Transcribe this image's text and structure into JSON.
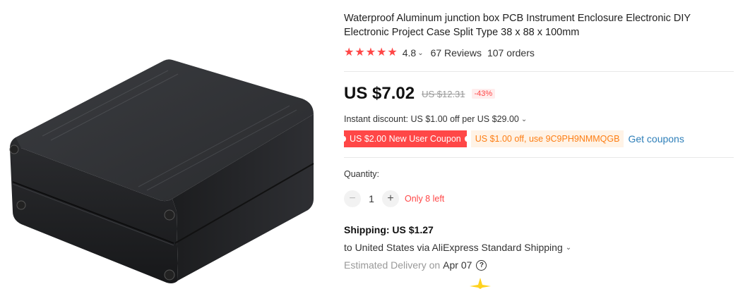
{
  "product": {
    "title": "Waterproof Aluminum junction box PCB Instrument Enclosure Electronic DIY Electronic Project Case Split Type 38 x 88 x 100mm",
    "image_alt": "Black aluminum enclosure box"
  },
  "rating": {
    "stars": 5,
    "value": "4.8",
    "reviews": "67 Reviews",
    "orders": "107 orders"
  },
  "price": {
    "current": "US $7.02",
    "original": "US $12.31",
    "discount": "-43%"
  },
  "instant_discount": "Instant discount: US $1.00 off per US $29.00",
  "coupons": {
    "new_user": "US $2.00 New User Coupon",
    "code_offer": "US $1.00 off, use 9C9PH9NMMQGB",
    "get_label": "Get coupons"
  },
  "quantity": {
    "label": "Quantity:",
    "value": "1",
    "minus": "−",
    "plus": "+",
    "stock": "Only 8 left"
  },
  "shipping": {
    "title": "Shipping: US $1.27",
    "destination": "to United States via AliExpress Standard Shipping",
    "delivery_label": "Estimated Delivery on",
    "delivery_date": "Apr 07"
  },
  "icons": {
    "star": "star-icon",
    "chevron": "chevron-down-icon",
    "help": "question-icon"
  },
  "colors": {
    "accent_red": "#ff4747",
    "coupon_orange": "#fd7e14",
    "link_blue": "#2e7fb9"
  }
}
